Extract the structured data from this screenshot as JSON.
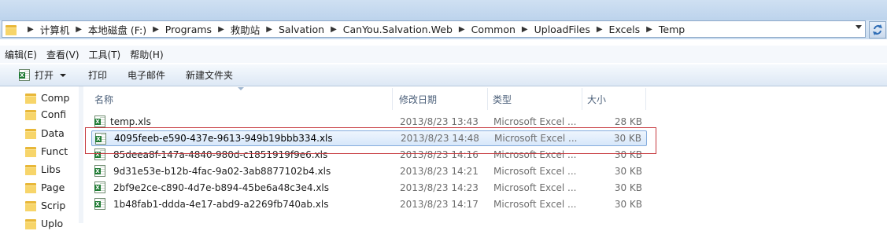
{
  "address_bar": {
    "breadcrumbs": [
      "计算机",
      "本地磁盘 (F:)",
      "Programs",
      "救助站",
      "Salvation",
      "CanYou.Salvation.Web",
      "Common",
      "UploadFiles",
      "Excels",
      "Temp"
    ]
  },
  "menu": {
    "items": [
      "编辑(E)",
      "查看(V)",
      "工具(T)",
      "帮助(H)"
    ]
  },
  "toolbar": {
    "open_label": "打开",
    "print_label": "打印",
    "email_label": "电子邮件",
    "new_folder_label": "新建文件夹"
  },
  "nav_pane": {
    "items": [
      "Comp",
      "Confi",
      "Data",
      "Funct",
      "Libs",
      "Page",
      "Scrip",
      "Uplo"
    ]
  },
  "columns": {
    "name": "名称",
    "date": "修改日期",
    "type": "类型",
    "size": "大小"
  },
  "files": [
    {
      "name": "temp.xls",
      "date": "2013/8/23 13:43",
      "type": "Microsoft Excel ...",
      "size": "28 KB",
      "selected": false
    },
    {
      "name": "4095feeb-e590-437e-9613-949b19bbb334.xls",
      "date": "2013/8/23 14:48",
      "type": "Microsoft Excel ...",
      "size": "30 KB",
      "selected": true
    },
    {
      "name": "85deea8f-147a-4840-980d-c1851919f9e6.xls",
      "date": "2013/8/23 14:16",
      "type": "Microsoft Excel ...",
      "size": "30 KB",
      "selected": false
    },
    {
      "name": "9d31e53e-b12b-4fac-9a02-3ab8877102b4.xls",
      "date": "2013/8/23 14:21",
      "type": "Microsoft Excel ...",
      "size": "30 KB",
      "selected": false
    },
    {
      "name": "2bf9e2ce-c890-4d7e-b894-45be6a48c3e4.xls",
      "date": "2013/8/23 14:23",
      "type": "Microsoft Excel ...",
      "size": "30 KB",
      "selected": false
    },
    {
      "name": "1b48fab1-ddda-4e17-abd9-a2269fb740ab.xls",
      "date": "2013/8/23 14:17",
      "type": "Microsoft Excel ...",
      "size": "30 KB",
      "selected": false
    }
  ],
  "icon_names": {
    "folder": "folder-icon",
    "excel": "excel-file-icon",
    "refresh": "refresh-icon"
  },
  "colors": {
    "selection_border": "#84acdd",
    "annotation_box": "#c6393e"
  }
}
